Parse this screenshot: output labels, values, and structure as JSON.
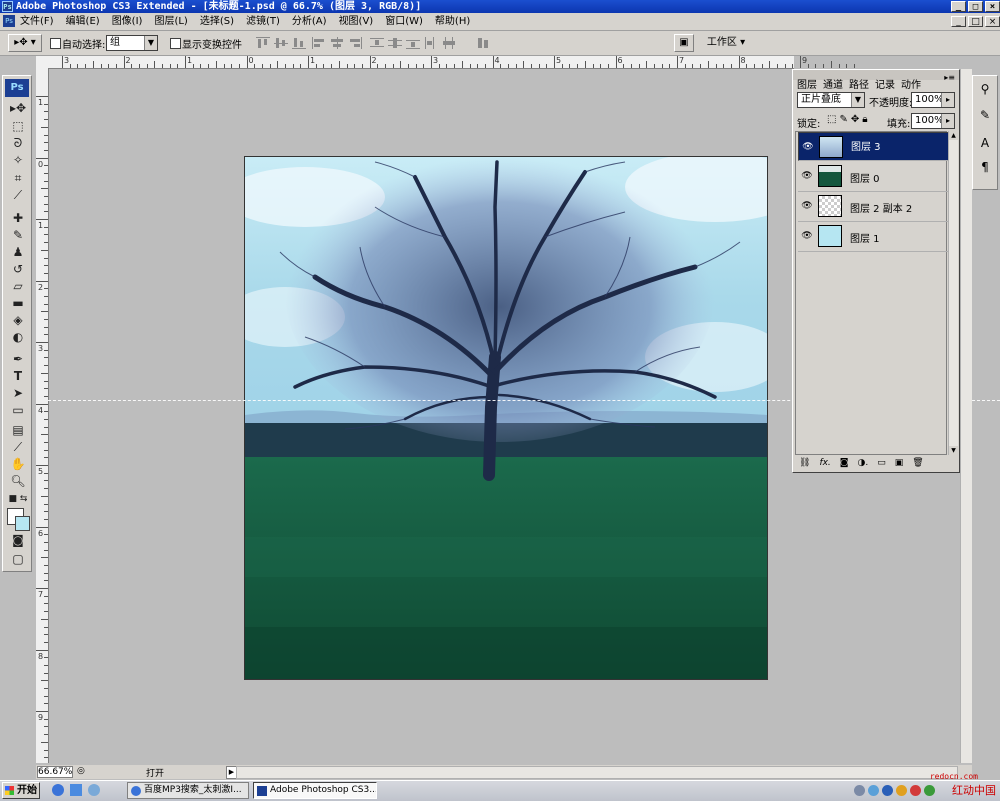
{
  "window": {
    "app_badge": "Ps",
    "title": "Adobe Photoshop CS3 Extended - [未标题-1.psd @ 66.7% (图层 3, RGB/8)]",
    "buttons": {
      "minimize": "_",
      "restore": "□",
      "close": "×"
    }
  },
  "menu": {
    "items": [
      "文件(F)",
      "编辑(E)",
      "图像(I)",
      "图层(L)",
      "选择(S)",
      "滤镜(T)",
      "分析(A)",
      "视图(V)",
      "窗口(W)",
      "帮助(H)"
    ]
  },
  "options": {
    "auto_select_label": "自动选择:",
    "auto_select_value": "组",
    "show_transform_label": "显示变换控件",
    "workspace_label": "工作区 ▾"
  },
  "toolbox": {
    "logo": "Ps"
  },
  "rulers": {
    "h_numbers": [
      "3",
      "2",
      "1",
      "0",
      "1",
      "2",
      "3",
      "4",
      "5",
      "6",
      "7",
      "8",
      "9"
    ],
    "v_numbers": [
      "1",
      "0",
      "1",
      "2",
      "3",
      "4",
      "5",
      "6",
      "7",
      "8",
      "9"
    ]
  },
  "layers_panel": {
    "tabs": [
      "图层",
      "通道",
      "路径",
      "记录",
      "动作"
    ],
    "blend_mode": "正片叠底",
    "opacity_label": "不透明度:",
    "opacity_value": "100%",
    "lock_label": "锁定:",
    "fill_label": "填充:",
    "fill_value": "100%",
    "layers": [
      {
        "name": "图层 3",
        "selected": true
      },
      {
        "name": "图层 0",
        "selected": false
      },
      {
        "name": "图层 2 副本 2",
        "selected": false
      },
      {
        "name": "图层 1",
        "selected": false
      }
    ]
  },
  "status": {
    "zoom": "66.67%",
    "message": "打开"
  },
  "taskbar": {
    "start_label": "开始",
    "items": [
      {
        "label": "百度MP3搜索_太刺激I..."
      },
      {
        "label": "Adobe Photoshop CS3..."
      }
    ]
  },
  "watermarks": {
    "small": "redocn.com",
    "brand": "红动中国"
  },
  "colors": {
    "title_bar": "#1b4fcf",
    "chrome": "#d6d3ce",
    "workspace": "#bdbdbd",
    "selected_layer": "#0a246a",
    "grass": "#14573e",
    "sky": "#a9d9ea"
  }
}
